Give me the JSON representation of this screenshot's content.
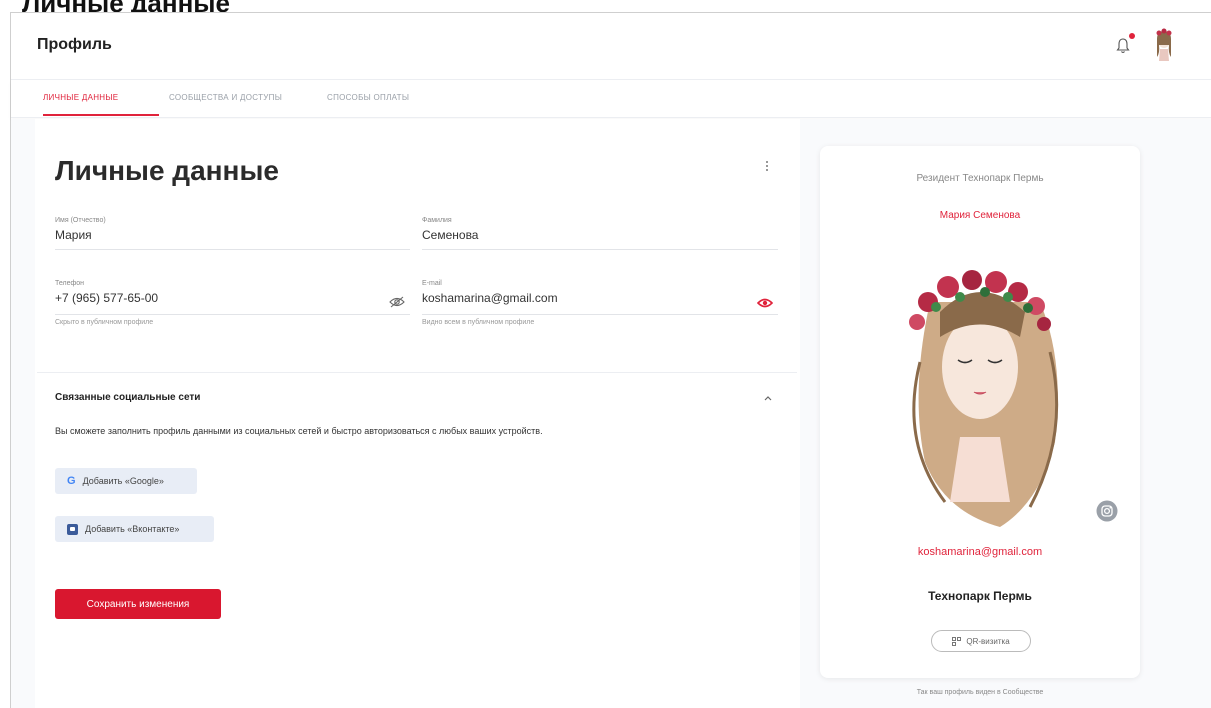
{
  "cut_title": "Личные данные",
  "header": {
    "title": "Профиль"
  },
  "tabs": [
    {
      "label": "Личные данные"
    },
    {
      "label": "Сообщества и доступы"
    },
    {
      "label": "Способы оплаты"
    }
  ],
  "main": {
    "title": "Личные данные",
    "fields": {
      "first_name": {
        "label": "Имя (Отчество)",
        "value": "Мария"
      },
      "last_name": {
        "label": "Фамилия",
        "value": "Семенова"
      },
      "phone": {
        "label": "Телефон",
        "value": "+7 (965) 577-65-00",
        "hint": "Скрыто в публичном профиле"
      },
      "email": {
        "label": "E-mail",
        "value": "koshamarina@gmail.com",
        "hint": "Видно всем в публичном профиле"
      }
    },
    "social": {
      "title": "Связанные социальные сети",
      "description": "Вы сможете заполнить профиль данными из социальных сетей и быстро авторизоваться с любых ваших устройств.",
      "google_label": "Добавить «Google»",
      "vk_label": "Добавить «Вконтакте»"
    },
    "save_label": "Сохранить изменения"
  },
  "card": {
    "resident": "Резидент Технопарк Пермь",
    "name": "Мария Семенова",
    "email": "koshamarina@gmail.com",
    "org": "Технопарк Пермь",
    "qr_label": "QR-визитка",
    "footer": "Так ваш профиль виден в Сообществе"
  },
  "colors": {
    "accent": "#e0233b",
    "button": "#d9172f",
    "social_button_bg": "#e8edf6"
  },
  "icons": [
    "bell-icon",
    "avatar",
    "kebab-menu-icon",
    "eye-off-icon",
    "eye-icon",
    "chevron-up-icon",
    "google-icon",
    "vk-icon",
    "instagram-icon",
    "qr-icon"
  ]
}
